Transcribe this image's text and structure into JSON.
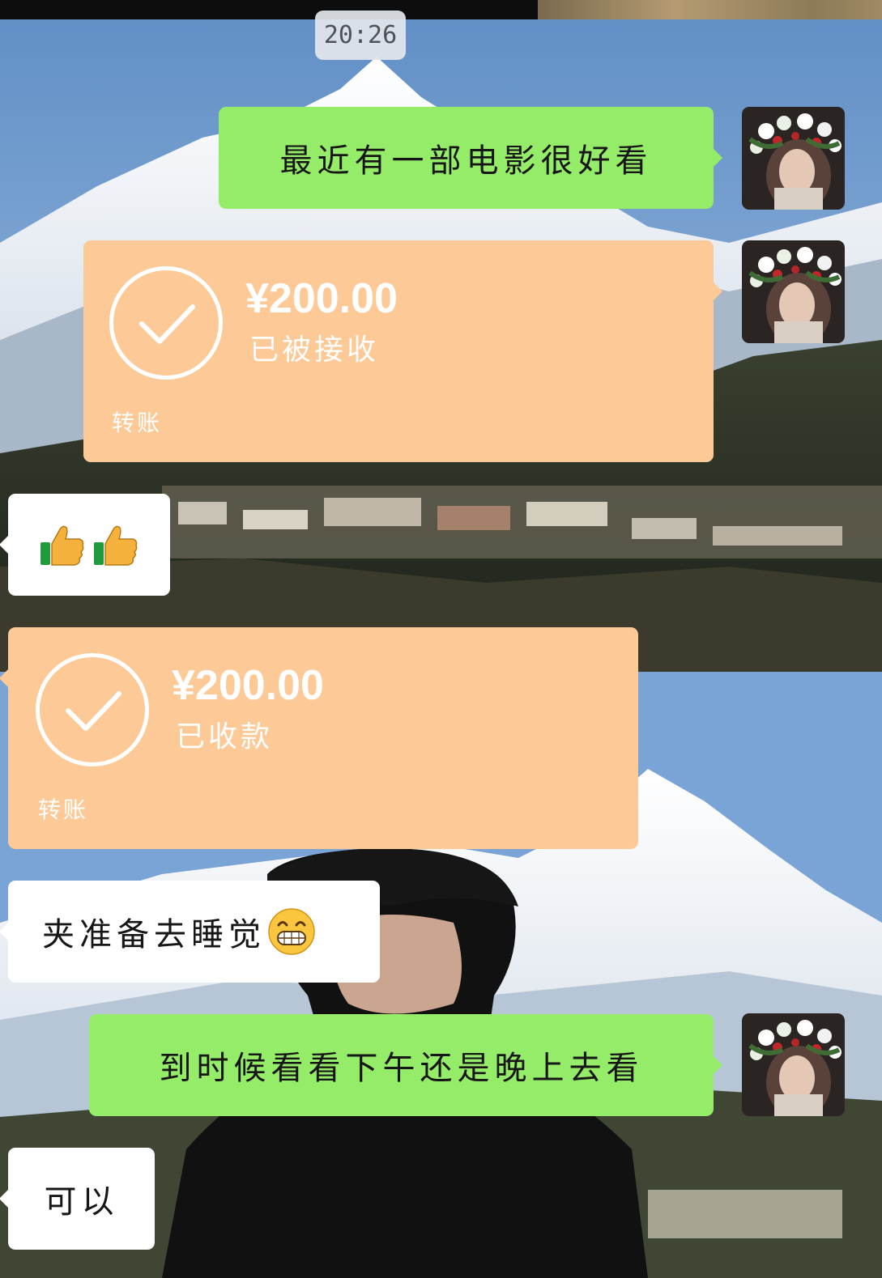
{
  "status_bar": {
    "time": "20:26"
  },
  "messages": [
    {
      "id": "m1",
      "side": "mine",
      "type": "text",
      "text": "最近有一部电影很好看"
    },
    {
      "id": "m2",
      "side": "mine",
      "type": "transfer",
      "amount": "¥200.00",
      "status": "已被接收",
      "label": "转账"
    },
    {
      "id": "m3",
      "side": "theirs",
      "type": "emoji",
      "emojis": [
        "thumbs-up-icon",
        "thumbs-up-icon"
      ]
    },
    {
      "id": "m4",
      "side": "theirs",
      "type": "transfer",
      "amount": "¥200.00",
      "status": "已收款",
      "label": "转账"
    },
    {
      "id": "m5",
      "side": "theirs",
      "type": "text",
      "text": "夹准备去睡觉",
      "trailing_emoji": "grinning-face-icon"
    },
    {
      "id": "m6",
      "side": "mine",
      "type": "text",
      "text": "到时候看看下午还是晚上去看"
    },
    {
      "id": "m7",
      "side": "theirs",
      "type": "text",
      "text": "可以"
    }
  ],
  "colors": {
    "my_bubble": "#95ec69",
    "their_bubble": "#ffffff",
    "transfer_card": "#fdca97",
    "timestamp_bg": "#e2e6ec"
  }
}
